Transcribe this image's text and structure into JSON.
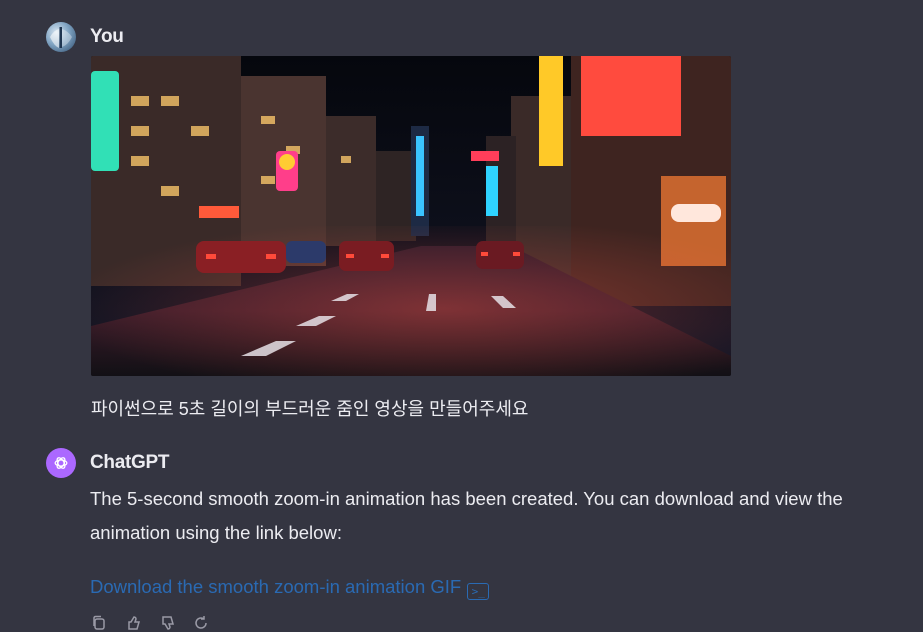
{
  "conversation": {
    "user_message": {
      "author": "You",
      "text": "파이썬으로 5초 길이의 부드러운 줌인 영상을 만들어주세요",
      "image_subject": "neon city street at night"
    },
    "assistant_message": {
      "author": "ChatGPT",
      "text": "The 5-second smooth zoom-in animation has been created. You can download and view the animation using the link below:",
      "link_text": "Download the smooth zoom-in animation GIF",
      "link_icon": "terminal-icon"
    }
  },
  "colors": {
    "background": "#343541",
    "text": "#ececf1",
    "link": "#2a6ab3",
    "assistant_avatar": "#ab68ff"
  },
  "icons": [
    "user-avatar-icon",
    "openai-logo-icon",
    "terminal-icon",
    "copy-icon",
    "thumbs-up-icon",
    "thumbs-down-icon",
    "regenerate-icon"
  ]
}
